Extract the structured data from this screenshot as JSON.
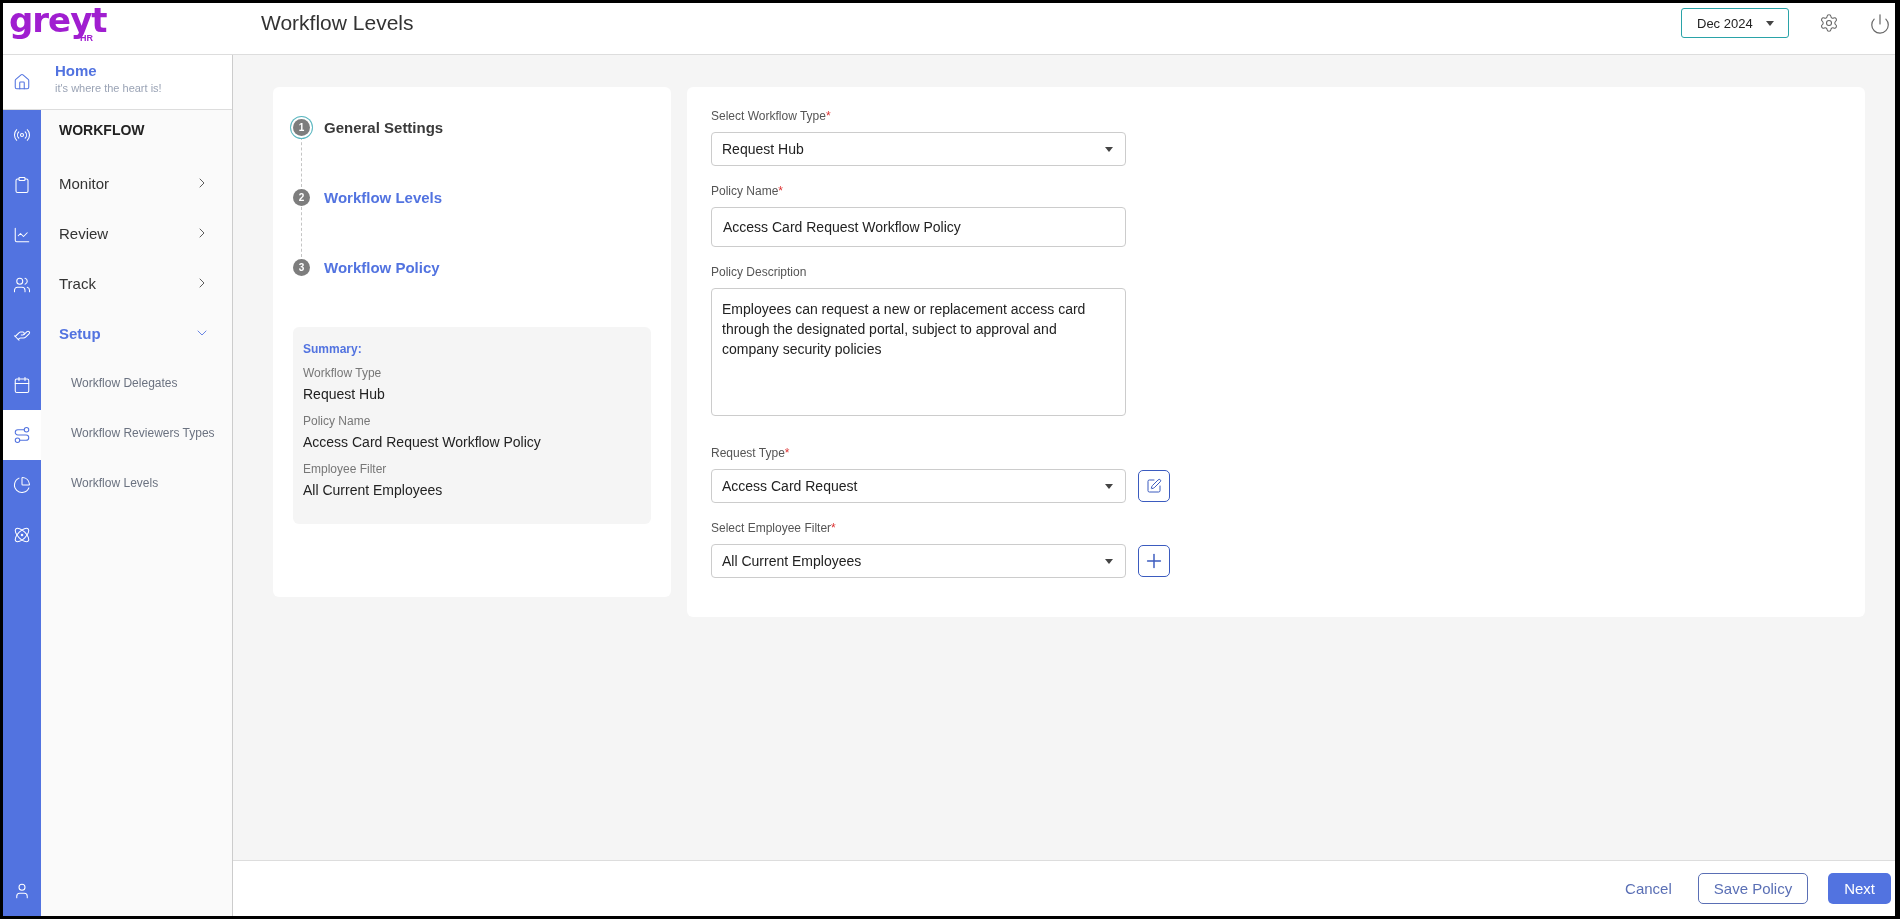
{
  "logo": {
    "text": "greyt",
    "sub": "HR"
  },
  "header": {
    "title": "Workflow Levels",
    "period": "Dec 2024"
  },
  "home": {
    "title": "Home",
    "subtitle": "it's where the heart is!"
  },
  "rail": [
    {
      "selected": false
    },
    {
      "selected": false
    },
    {
      "selected": false
    },
    {
      "selected": false
    },
    {
      "selected": false
    },
    {
      "selected": false
    },
    {
      "selected": true
    },
    {
      "selected": false
    },
    {
      "selected": false
    }
  ],
  "menu": {
    "heading": "WORKFLOW",
    "items": [
      {
        "label": "Monitor",
        "expanded": false
      },
      {
        "label": "Review",
        "expanded": false
      },
      {
        "label": "Track",
        "expanded": false
      },
      {
        "label": "Setup",
        "expanded": true,
        "children": [
          {
            "label": "Workflow Delegates"
          },
          {
            "label": "Workflow Reviewers Types"
          },
          {
            "label": "Workflow Levels"
          }
        ]
      }
    ]
  },
  "steps": [
    {
      "number": "1",
      "label": "General Settings",
      "active": true
    },
    {
      "number": "2",
      "label": "Workflow Levels",
      "active": false
    },
    {
      "number": "3",
      "label": "Workflow Policy",
      "active": false
    }
  ],
  "summary": {
    "title": "Summary:",
    "items": [
      {
        "label": "Workflow Type",
        "value": "Request Hub"
      },
      {
        "label": "Policy Name",
        "value": "Access Card Request Workflow Policy"
      },
      {
        "label": "Employee Filter",
        "value": "All Current Employees"
      }
    ]
  },
  "form": [
    {
      "kind": "select",
      "label": "Select Workflow Type",
      "required": "*",
      "value": "Request Hub"
    },
    {
      "kind": "text",
      "label": "Policy Name",
      "required": "*",
      "value": "Access Card Request Workflow Policy"
    },
    {
      "kind": "textarea",
      "label": "Policy Description",
      "value": "Employees can request a new or replacement access card through the designated portal, subject to approval and company security policies"
    },
    {
      "kind": "select",
      "label": "Request Type",
      "required": "*",
      "value": "Access Card Request"
    },
    {
      "kind": "select",
      "label": "Select Employee Filter",
      "required": "*",
      "value": "All Current Employees"
    }
  ],
  "footer": {
    "cancel": "Cancel",
    "save": "Save Policy",
    "next": "Next"
  }
}
